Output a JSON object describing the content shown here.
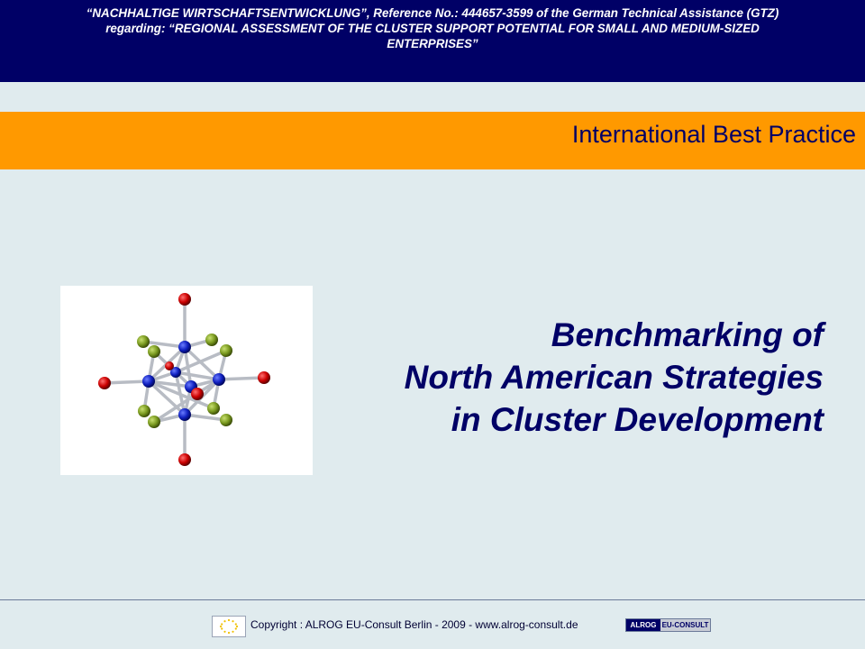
{
  "header": {
    "line1": "“NACHHALTIGE WIRTSCHAFTSENTWICKLUNG”, Reference No.: 444657-3599 of the German Technical Assistance (GTZ)",
    "line2": "regarding: “REGIONAL ASSESSMENT OF THE CLUSTER SUPPORT POTENTIAL FOR SMALL AND MEDIUM-SIZED",
    "line3": "ENTERPRISES”"
  },
  "section": {
    "title": "International Best Practice"
  },
  "main": {
    "title_lines": [
      "Benchmarking of",
      "North American Strategies",
      "in Cluster Development"
    ]
  },
  "footer": {
    "copyright": "Copyright : ALROG EU-Consult Berlin - 2009   - www.alrog-consult.de",
    "logo_part1": "ALROG",
    "logo_part2": "EU-CONSULT"
  },
  "colors": {
    "navy": "#000066",
    "orange": "#ff9900",
    "background": "#e0ebee"
  },
  "icons": [
    "molecule-cluster-image",
    "eu-flag-icon",
    "alrog-logo"
  ]
}
